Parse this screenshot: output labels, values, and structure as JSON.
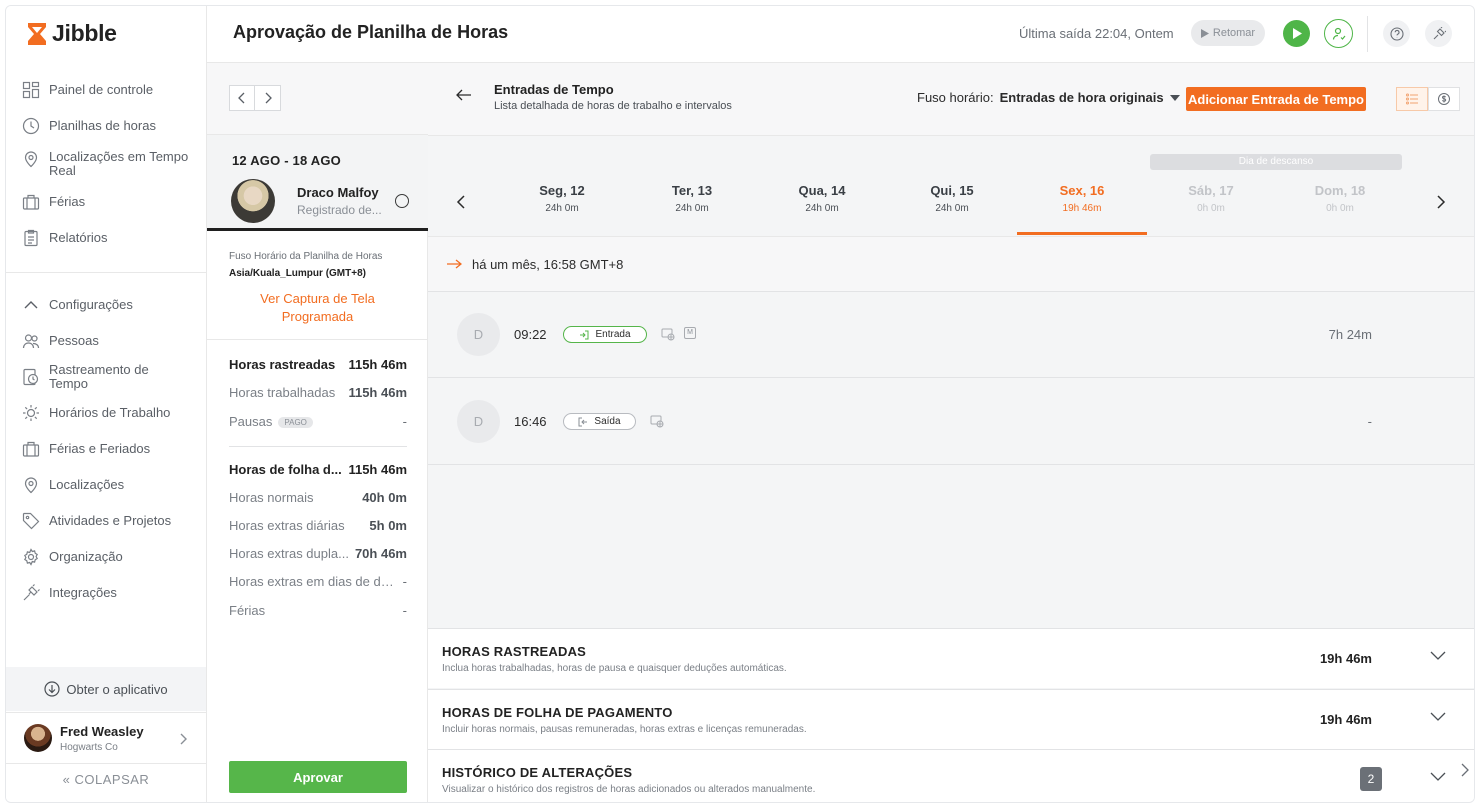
{
  "app": {
    "brand": "Jibble",
    "brand_color": "#f26d21",
    "success_color": "#56b64a"
  },
  "sidebar": {
    "items": [
      {
        "label": "Painel de controle",
        "icon": "dashboard-icon"
      },
      {
        "label": "Planilhas de horas",
        "icon": "clock-icon"
      },
      {
        "label": "Localizações em Tempo Real",
        "icon": "location-pin-icon"
      },
      {
        "label": "Férias",
        "icon": "suitcase-icon"
      },
      {
        "label": "Relatórios",
        "icon": "clipboard-icon"
      }
    ],
    "settings_header": "Configurações",
    "settings_items": [
      {
        "label": "Pessoas",
        "icon": "people-icon"
      },
      {
        "label": "Rastreamento de Tempo",
        "icon": "time-tracking-icon"
      },
      {
        "label": "Horários de Trabalho",
        "icon": "sun-schedule-icon"
      },
      {
        "label": "Férias e Feriados",
        "icon": "suitcase-icon"
      },
      {
        "label": "Localizações",
        "icon": "location-pin-icon"
      },
      {
        "label": "Atividades e Projetos",
        "icon": "tag-icon"
      },
      {
        "label": "Organização",
        "icon": "gear-icon"
      },
      {
        "label": "Integrações",
        "icon": "plug-icon"
      }
    ],
    "get_app": "Obter o aplicativo",
    "user": {
      "name": "Fred Weasley",
      "org": "Hogwarts Co"
    },
    "collapse": "COLAPSAR"
  },
  "header": {
    "title": "Aprovação de Planilha de Horas",
    "last_out": "Última saída 22:04, Ontem",
    "resume": "Retomar"
  },
  "middle": {
    "week_range": "12 AGO - 18 AGO",
    "employee": {
      "name": "Draco Malfoy",
      "status": "Registrado de..."
    },
    "tz_label": "Fuso Horário da Planilha de Horas",
    "tz_value": "Asia/Kuala_Lumpur (GMT+8)",
    "screenshot_link": "Ver Captura de Tela Programada",
    "tracked": [
      {
        "label": "Horas rastreadas",
        "value": "115h 46m",
        "bold": true
      },
      {
        "label": "Horas trabalhadas",
        "value": "115h 46m"
      },
      {
        "label": "Pausas",
        "value": "-",
        "badge": "PAGO"
      }
    ],
    "payroll": [
      {
        "label": "Horas de folha d...",
        "value": "115h 46m",
        "bold": true
      },
      {
        "label": "Horas normais",
        "value": "40h 0m"
      },
      {
        "label": "Horas extras diárias",
        "value": "5h 0m"
      },
      {
        "label": "Horas extras dupla...",
        "value": "70h 46m"
      },
      {
        "label": "Horas extras em dias de de...",
        "value": "-"
      },
      {
        "label": "Férias",
        "value": "-"
      }
    ],
    "approve": "Aprovar"
  },
  "entries_panel": {
    "title": "Entradas de Tempo",
    "subtitle": "Lista detalhada de horas de trabalho e intervalos",
    "tz_prefix": "Fuso horário:",
    "tz_value": "Entradas de hora originais",
    "add_button": "Adicionar Entrada de Tempo",
    "rest_day": "Dia de descanso",
    "days": [
      {
        "name": "Seg, 12",
        "hours": "24h 0m"
      },
      {
        "name": "Ter, 13",
        "hours": "24h 0m"
      },
      {
        "name": "Qua, 14",
        "hours": "24h 0m"
      },
      {
        "name": "Qui, 15",
        "hours": "24h 0m"
      },
      {
        "name": "Sex, 16",
        "hours": "19h 46m",
        "active": true
      },
      {
        "name": "Sáb, 17",
        "hours": "0h 0m",
        "muted": true
      },
      {
        "name": "Dom, 18",
        "hours": "0h 0m",
        "muted": true
      }
    ],
    "since": "há um mês, 16:58 GMT+8",
    "entries": [
      {
        "initial": "D",
        "time": "09:22",
        "type": "Entrada",
        "duration": "7h 24m",
        "manual_badge": "M"
      },
      {
        "initial": "D",
        "time": "16:46",
        "type": "Saída",
        "duration": "-"
      }
    ],
    "sections": [
      {
        "title": "HORAS RASTREADAS",
        "subtitle": "Inclua horas trabalhadas, horas de pausa e quaisquer deduções automáticas.",
        "value": "19h 46m"
      },
      {
        "title": "HORAS DE FOLHA DE PAGAMENTO",
        "subtitle": "Incluir horas normais, pausas remuneradas, horas extras e licenças remuneradas.",
        "value": "19h 46m"
      },
      {
        "title": "HISTÓRICO DE ALTERAÇÕES",
        "subtitle": "Visualizar o histórico dos registros de horas adicionados ou alterados manualmente.",
        "count": "2"
      }
    ]
  }
}
